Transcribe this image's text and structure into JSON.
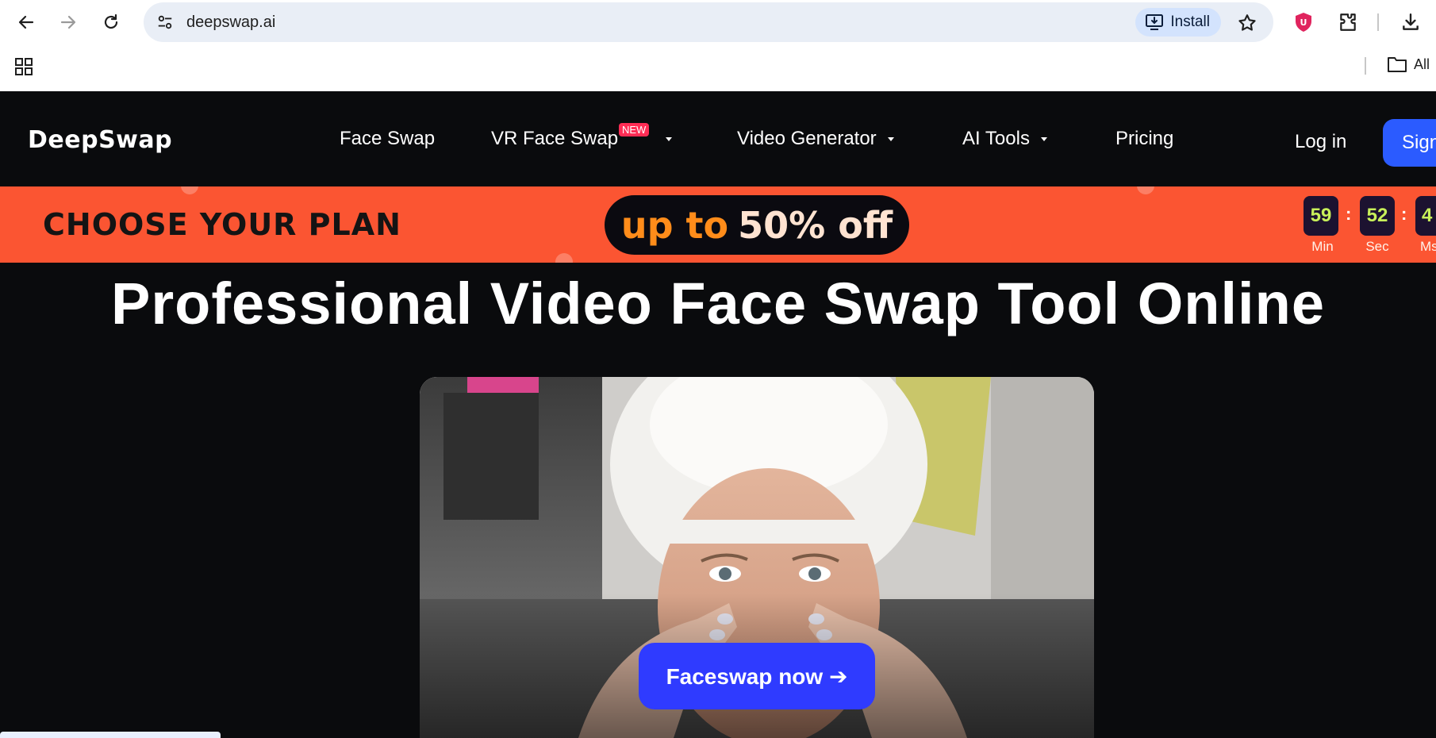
{
  "browser": {
    "url": "deepswap.ai",
    "install_label": "Install",
    "bookmarks_label": "All"
  },
  "site": {
    "logo": "DeepSwap",
    "nav": {
      "face_swap": "Face Swap",
      "vr_face_swap": "VR Face Swap",
      "new_badge": "NEW",
      "video_generator": "Video Generator",
      "ai_tools": "AI Tools",
      "pricing": "Pricing",
      "login": "Log in",
      "signup": "Sign"
    },
    "promo": {
      "title": "CHOOSE YOUR PLAN",
      "up_to": "up to",
      "discount": "50% off",
      "countdown": [
        {
          "value": "59",
          "label": "Min"
        },
        {
          "value": "52",
          "label": "Sec"
        },
        {
          "value": "4",
          "label": "Ms"
        }
      ],
      "separator": ":"
    },
    "hero": {
      "title": "Professional Video Face Swap Tool Online",
      "cta": "Faceswap now ➔"
    }
  },
  "colors": {
    "background": "#0a0b0d",
    "promo_bg": "#fb5532",
    "accent_blue": "#2b5bff",
    "cta_blue": "#2f3bff",
    "badge_red": "#ff2d55",
    "countdown_text": "#c8f05a"
  }
}
